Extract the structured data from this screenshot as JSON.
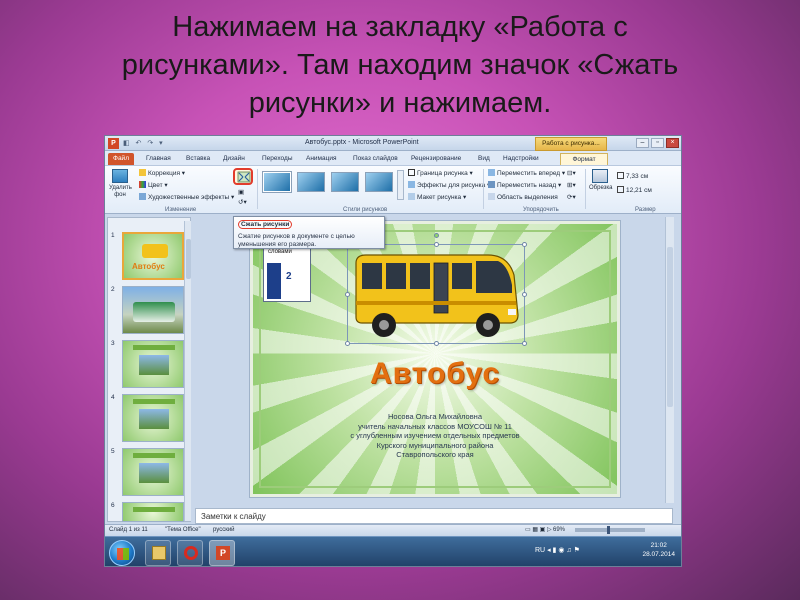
{
  "heading": {
    "line1": "Нажимаем на закладку «Работа с",
    "line2": "рисунками». Там находим значок «Сжать",
    "line3": "рисунки» и нажимаем."
  },
  "window": {
    "title": "Автобус.pptx - Microsoft PowerPoint",
    "context_tab_group": "Работа с рисунка...",
    "app_icon": "P"
  },
  "tabs": [
    "Файл",
    "Главная",
    "Вставка",
    "Дизайн",
    "Переходы",
    "Анимация",
    "Показ слайдов",
    "Рецензирование",
    "Вид",
    "Надстройки",
    "Формат"
  ],
  "ribbon": {
    "remove_bg": "Удалить фон",
    "correction": "Коррекция",
    "color": "Цвет",
    "artistic": "Художественные эффекты",
    "group_change": "Изменение",
    "group_styles": "Стили рисунков",
    "border": "Граница рисунка",
    "effects": "Эффекты для рисунка",
    "layout": "Макет рисунка",
    "bring_forward": "Переместить вперед",
    "send_back": "Переместить назад",
    "selection_pane": "Область выделения",
    "group_arrange": "Упорядочить",
    "crop": "Обрезка",
    "height": "7,33 см",
    "width": "12,21 см",
    "group_size": "Размер"
  },
  "tooltip": {
    "title": "Сжать рисунки",
    "description": "Сжатие рисунков в документе с целью уменьшения его размера."
  },
  "slide": {
    "book_title": "Работа со словарными словами",
    "book_number": "2",
    "title": "Автобус",
    "info": [
      "Носова Ольга Михайловна",
      "учитель начальных классов МОУСОШ № 11",
      "с углубленным изучением отдельных предметов",
      "Курского муниципального района",
      "Ставропольского края"
    ]
  },
  "thumbnails": [
    "1",
    "2",
    "3",
    "4",
    "5",
    "6"
  ],
  "thumb_title": "Автобус",
  "notes_placeholder": "Заметки к слайду",
  "status": {
    "slide": "Слайд 1 из 11",
    "theme": "\"Тема Office\"",
    "language": "русский",
    "zoom": "69%"
  },
  "tray": {
    "lang": "RU",
    "time": "21:02",
    "date": "28.07.2014"
  }
}
